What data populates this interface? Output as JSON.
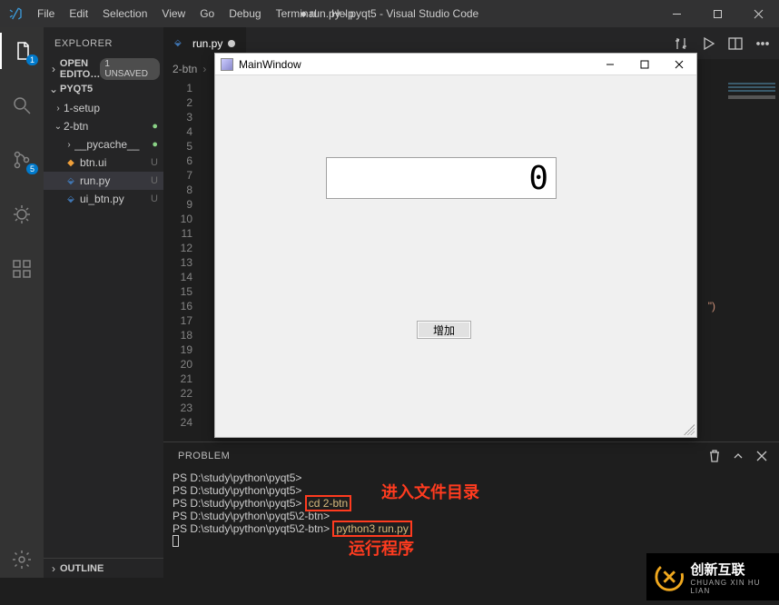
{
  "titlebar": {
    "menu": [
      "File",
      "Edit",
      "Selection",
      "View",
      "Go",
      "Debug",
      "Terminal",
      "Help"
    ],
    "title_dot": "●",
    "title": "run.py - pyqt5 - Visual Studio Code"
  },
  "activity": {
    "badge_explorer": "1",
    "badge_scm": "5"
  },
  "sidebar": {
    "head": "EXPLORER",
    "open_editors": {
      "label": "OPEN EDITO…",
      "badge": "1 UNSAVED"
    },
    "root": "PYQT5",
    "tree": [
      {
        "kind": "folder",
        "depth": 0,
        "open": false,
        "name": "1-setup"
      },
      {
        "kind": "folder",
        "depth": 0,
        "open": true,
        "name": "2-btn",
        "status": "dot"
      },
      {
        "kind": "folder",
        "depth": 1,
        "open": false,
        "name": "__pycache__",
        "status": "dot"
      },
      {
        "kind": "file",
        "depth": 1,
        "icon": "ui",
        "name": "btn.ui",
        "status": "U"
      },
      {
        "kind": "file",
        "depth": 1,
        "icon": "py",
        "name": "run.py",
        "status": "U",
        "selected": true
      },
      {
        "kind": "file",
        "depth": 1,
        "icon": "py",
        "name": "ui_btn.py",
        "status": "U"
      }
    ],
    "outline": "OUTLINE"
  },
  "editor": {
    "tab": {
      "name": "run.py"
    },
    "breadcrumb": [
      "2-btn"
    ],
    "line_count": 24,
    "code_hint": "\")"
  },
  "panel": {
    "tab": "PROBLEM",
    "lines": [
      {
        "prefix": "PS ",
        "path": "D:\\study\\python\\pyqt5>"
      },
      {
        "prefix": "PS ",
        "path": "D:\\study\\python\\pyqt5>"
      },
      {
        "prefix": "PS ",
        "path": "D:\\study\\python\\pyqt5>",
        "cmd": "cd 2-btn",
        "hl": 1
      },
      {
        "prefix": "PS ",
        "path": "D:\\study\\python\\pyqt5\\2-btn>"
      },
      {
        "prefix": "PS ",
        "path": "D:\\study\\python\\pyqt5\\2-btn>",
        "cmd": "python3 run.py",
        "hl": 2
      }
    ],
    "anno1": "进入文件目录",
    "anno2": "运行程序"
  },
  "appwin": {
    "title": "MainWindow",
    "display": "0",
    "button": "增加"
  },
  "watermark": {
    "brand": "创新互联",
    "sub": "CHUANG XIN HU LIAN"
  }
}
